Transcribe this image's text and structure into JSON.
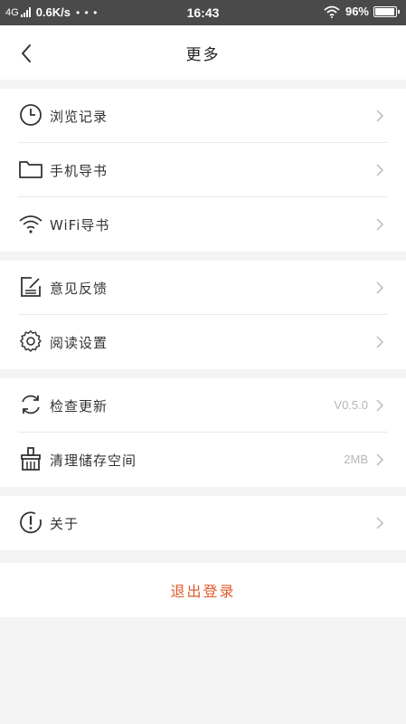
{
  "status_bar": {
    "network": "4G",
    "speed": "0.6K/s",
    "dots": "• • •",
    "time": "16:43",
    "battery": "96%"
  },
  "header": {
    "title": "更多"
  },
  "groups": [
    {
      "items": [
        {
          "label": "浏览记录",
          "icon": "clock-icon"
        },
        {
          "label": "手机导书",
          "icon": "folder-icon"
        },
        {
          "label": "WiFi导书",
          "icon": "wifi-icon"
        }
      ]
    },
    {
      "items": [
        {
          "label": "意见反馈",
          "icon": "feedback-icon"
        },
        {
          "label": "阅读设置",
          "icon": "gear-icon"
        }
      ]
    },
    {
      "items": [
        {
          "label": "检查更新",
          "icon": "refresh-icon",
          "value": "V0.5.0"
        },
        {
          "label": "清理储存空间",
          "icon": "broom-icon",
          "value": "2MB"
        }
      ]
    },
    {
      "items": [
        {
          "label": "关于",
          "icon": "info-icon"
        }
      ]
    }
  ],
  "logout": {
    "label": "退出登录",
    "color": "#e05a2b"
  }
}
